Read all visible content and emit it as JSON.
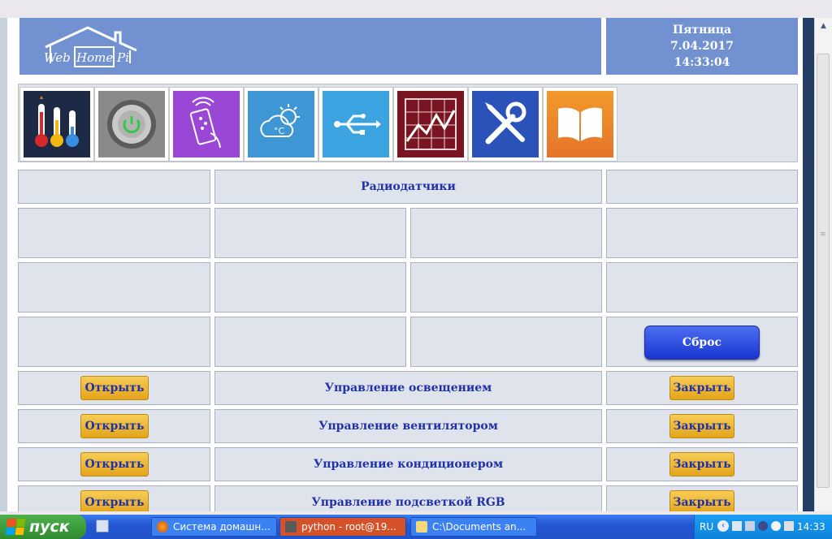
{
  "header": {
    "logo_words": [
      "Web",
      "Home",
      "Pi"
    ],
    "day": "Пятница",
    "date": "7.04.2017",
    "time": "14:33:04"
  },
  "icons": [
    "thermometer-icon",
    "power-icon",
    "remote-control-icon",
    "weather-icon",
    "usb-icon",
    "chart-icon",
    "tools-icon",
    "book-icon"
  ],
  "section_title": "Радиодатчики",
  "reset_label": "Сброс",
  "controls": [
    {
      "open": "Открыть",
      "label": "Управление освещением",
      "close": "Закрыть"
    },
    {
      "open": "Открыть",
      "label": "Управление вентилятором",
      "close": "Закрыть"
    },
    {
      "open": "Открыть",
      "label": "Управление кондиционером",
      "close": "Закрыть"
    },
    {
      "open": "Открыть",
      "label": "Управление подсветкой RGB",
      "close": "Закрыть"
    }
  ],
  "taskbar": {
    "start_label": "пуск",
    "tasks": [
      "Система домашн...",
      "python - root@19...",
      "C:\\Documents an..."
    ],
    "lang": "RU",
    "clock": "14:33"
  },
  "colors": {
    "header_blue": "#7191d1",
    "cell_bg": "#dfe4ec",
    "text_blue": "#2131a8",
    "button_yellow": "#f0b832",
    "button_blue": "#2a4be0"
  }
}
